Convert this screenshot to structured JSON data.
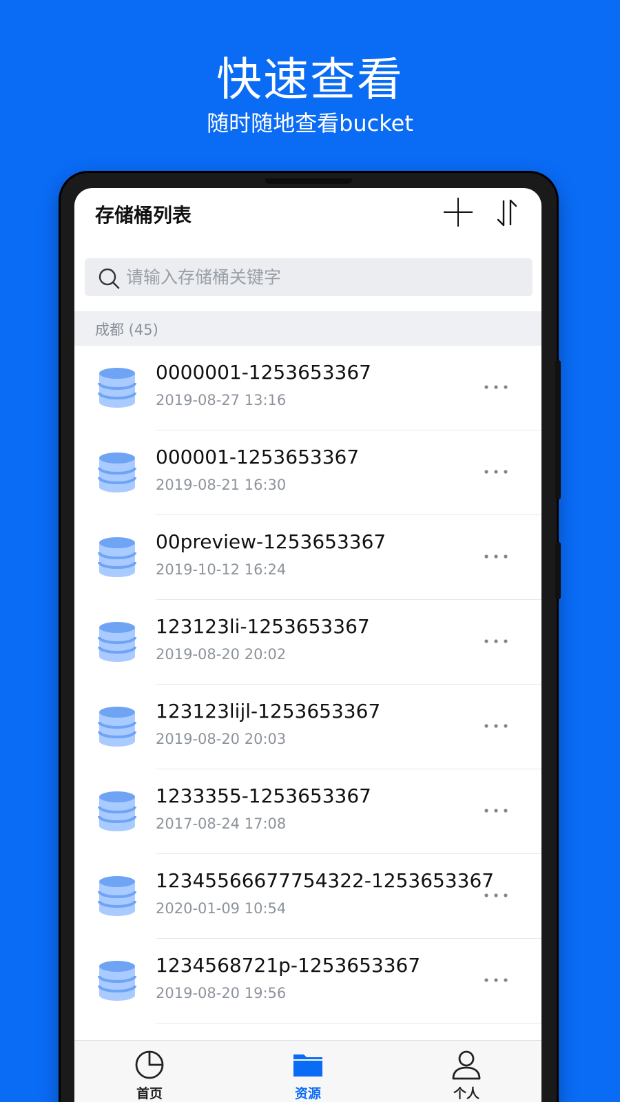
{
  "promo": {
    "title": "快速查看",
    "subtitle": "随时随地查看bucket"
  },
  "header": {
    "title": "存储桶列表",
    "add_icon": "plus-icon",
    "sort_icon": "sort-icon"
  },
  "search": {
    "placeholder": "请输入存储桶关键字",
    "value": ""
  },
  "section": {
    "label": "成都 (45)"
  },
  "buckets": [
    {
      "name": "0000001-1253653367",
      "date": "2019-08-27 13:16"
    },
    {
      "name": "000001-1253653367",
      "date": "2019-08-21 16:30"
    },
    {
      "name": "00preview-1253653367",
      "date": "2019-10-12 16:24"
    },
    {
      "name": "123123li-1253653367",
      "date": "2019-08-20 20:02"
    },
    {
      "name": "123123lijl-1253653367",
      "date": "2019-08-20 20:03"
    },
    {
      "name": "1233355-1253653367",
      "date": "2017-08-24 17:08"
    },
    {
      "name": "12345566677754322-1253653367",
      "date": "2020-01-09 10:54"
    },
    {
      "name": "1234568721p-1253653367",
      "date": "2019-08-20 19:56"
    }
  ],
  "tabs": [
    {
      "label": "首页",
      "icon": "pie-chart-icon",
      "active": false
    },
    {
      "label": "资源",
      "icon": "folder-icon",
      "active": true
    },
    {
      "label": "个人",
      "icon": "user-icon",
      "active": false
    }
  ],
  "colors": {
    "brand": "#0A6BF5",
    "db_icon_light": "#A9CBFF",
    "db_icon_dark": "#6FA4F5"
  }
}
